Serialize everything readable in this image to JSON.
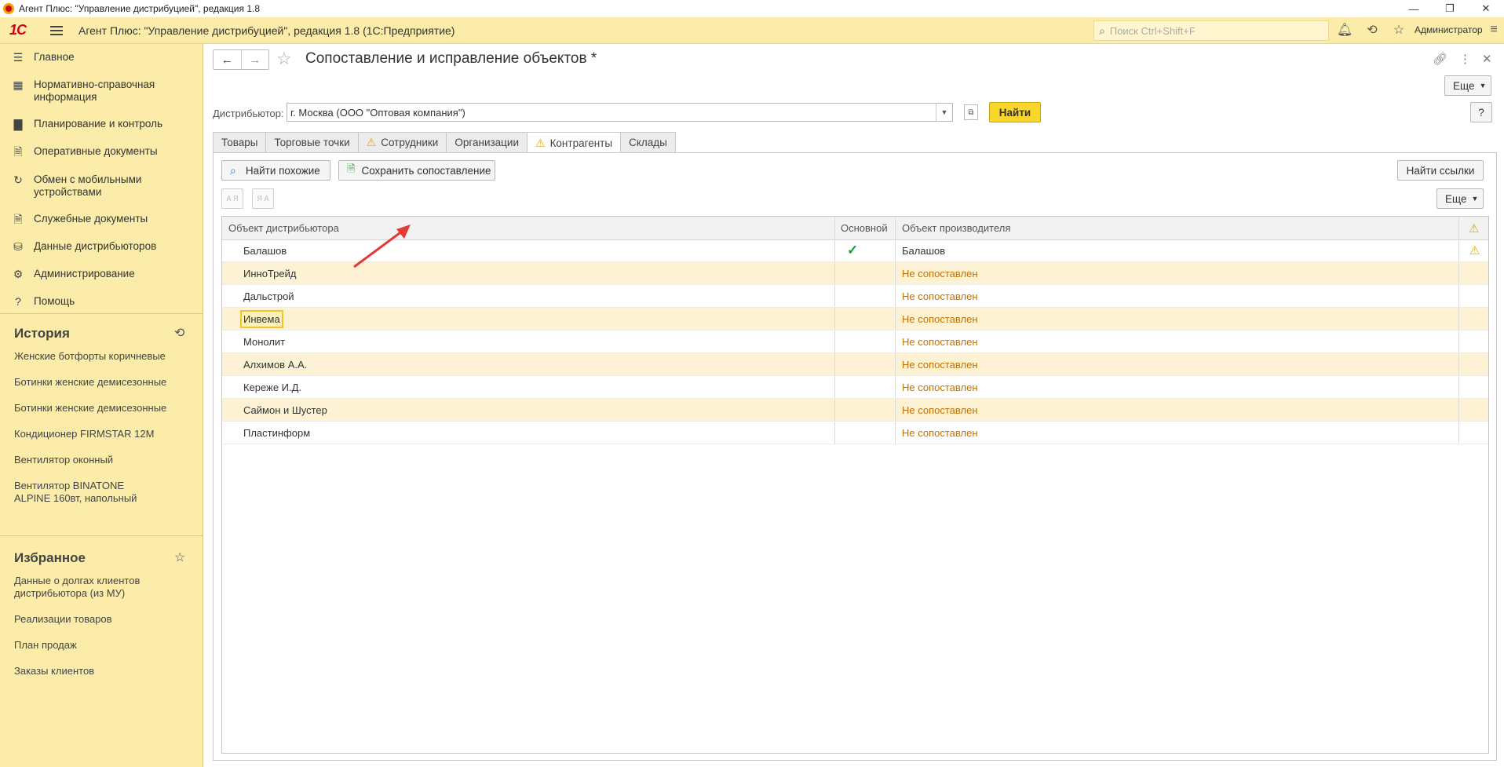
{
  "window": {
    "title": "Агент Плюс: \"Управление дистрибуцией\", редакция 1.8",
    "controls": [
      "—",
      "❐",
      "✕"
    ]
  },
  "header": {
    "logo": "1С",
    "app_title": "Агент Плюс: \"Управление дистрибуцией\", редакция 1.8  (1С:Предприятие)",
    "search_placeholder": "Поиск Ctrl+Shift+F",
    "user": "Администратор"
  },
  "sidebar": {
    "items": [
      {
        "icon": "menu-lines-icon",
        "label": "Главное"
      },
      {
        "icon": "reference-grid-icon",
        "label": "Нормативно-справочная информация"
      },
      {
        "icon": "chart-icon",
        "label": "Планирование и контроль"
      },
      {
        "icon": "documents-icon",
        "label": "Оперативные документы"
      },
      {
        "icon": "sync-icon",
        "label": "Обмен с мобильными устройствами"
      },
      {
        "icon": "documents-icon",
        "label": "Служебные документы"
      },
      {
        "icon": "distributors-icon",
        "label": "Данные дистрибьюторов"
      },
      {
        "icon": "gear-icon",
        "label": "Администрирование"
      },
      {
        "icon": "question-icon",
        "label": "Помощь"
      }
    ],
    "history_title": "История",
    "history": [
      "Женские ботфорты коричневые",
      "Ботинки женские демисезонные",
      "Ботинки женские демисезонные",
      "Кондиционер FIRMSTAR 12M",
      "Вентилятор оконный",
      "Вентилятор BINATONE ALPINE 160вт, напольный"
    ],
    "favorites_title": "Избранное",
    "favorites": [
      "Данные о долгах клиентов дистрибьютора (из МУ)",
      "Реализации товаров",
      "План продаж",
      "Заказы клиентов"
    ]
  },
  "form": {
    "title": "Сопоставление и исправление объектов *",
    "more_label": "Еще",
    "help_label": "?",
    "distributor_label": "Дистрибьютор:",
    "distributor_value": "г. Москва  (ООО \"Оптовая компания\")",
    "find_label": "Найти",
    "tabs": [
      {
        "label": "Товары",
        "warn": false
      },
      {
        "label": "Торговые точки",
        "warn": false
      },
      {
        "label": "Сотрудники",
        "warn": true
      },
      {
        "label": "Организации",
        "warn": false
      },
      {
        "label": "Контрагенты",
        "warn": true,
        "active": true
      },
      {
        "label": "Склады",
        "warn": false
      }
    ],
    "find_similar_label": "Найти похожие",
    "save_mapping_label": "Сохранить сопоставление",
    "find_links_label": "Найти ссылки",
    "table_more_label": "Еще",
    "sort_asc": "А Я",
    "sort_desc": "Я А",
    "table": {
      "headers": {
        "distributor_object": "Объект дистрибьютора",
        "main": "Основной",
        "manufacturer_object": "Объект производителя"
      },
      "rows": [
        {
          "distributor": "Балашов",
          "main": "✓",
          "manufacturer": "Балашов",
          "warn": "⚠",
          "status": false
        },
        {
          "distributor": "ИнноТрейд",
          "main": "",
          "manufacturer": "Не сопоставлен",
          "warn": "",
          "status": true
        },
        {
          "distributor": "Дальстрой",
          "main": "",
          "manufacturer": "Не сопоставлен",
          "warn": "",
          "status": true
        },
        {
          "distributor": "Инвема",
          "main": "",
          "manufacturer": "Не сопоставлен",
          "warn": "",
          "status": true,
          "current": true
        },
        {
          "distributor": "Монолит",
          "main": "",
          "manufacturer": "Не сопоставлен",
          "warn": "",
          "status": true
        },
        {
          "distributor": "Алхимов А.А.",
          "main": "",
          "manufacturer": "Не сопоставлен",
          "warn": "",
          "status": true
        },
        {
          "distributor": "Кереже И.Д.",
          "main": "",
          "manufacturer": "Не сопоставлен",
          "warn": "",
          "status": true
        },
        {
          "distributor": "Саймон и Шустер",
          "main": "",
          "manufacturer": "Не сопоставлен",
          "warn": "",
          "status": true
        },
        {
          "distributor": "Пластинформ",
          "main": "",
          "manufacturer": "Не сопоставлен",
          "warn": "",
          "status": true
        }
      ]
    }
  },
  "colors": {
    "sidebar_bg": "#fbeca9",
    "accent_button": "#f8d62b",
    "status_text": "#c07100",
    "check": "#1a9e3a",
    "selected_row": "#fdf3d4"
  }
}
